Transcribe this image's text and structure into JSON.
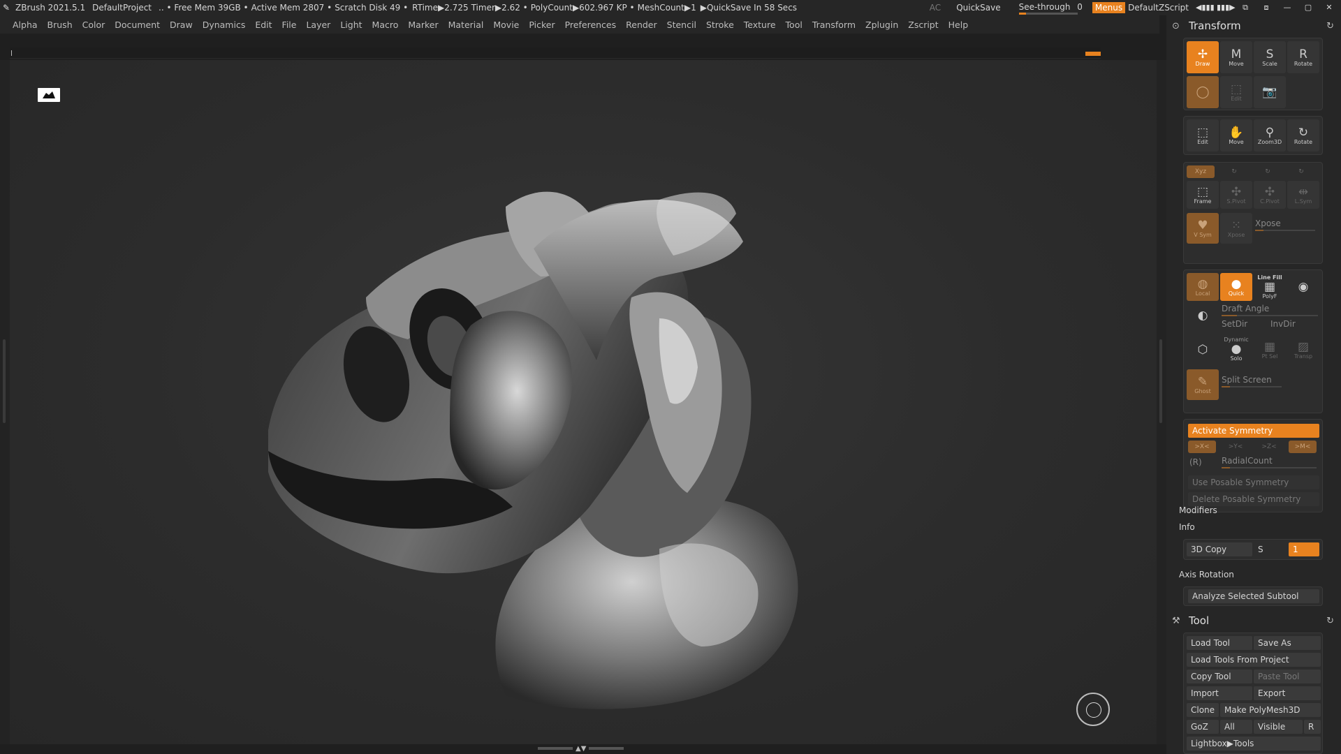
{
  "titlebar": {
    "app": "ZBrush 2021.5.1",
    "project": "DefaultProject",
    "free_mem": ".. • Free Mem 39GB •",
    "active_mem": "Active Mem 2807 •",
    "scratch": "Scratch Disk 49 •",
    "rtime": "RTime▶2.725",
    "timer": "Timer▶2.62 •",
    "polycount": "PolyCount▶602.967 KP •",
    "meshcount": "MeshCount▶1",
    "quicksave_timer": "▶QuickSave In 58 Secs",
    "ac": "AC",
    "quicksave": "QuickSave",
    "seethrough": "See-through",
    "seethrough_value": "0",
    "menus": "Menus",
    "script": "DefaultZScript",
    "icons": [
      "◀▮▮▮",
      "▮▮▮▶",
      "⧉",
      "⧈",
      "—",
      "▢",
      "✕"
    ]
  },
  "menubar": [
    "Alpha",
    "Brush",
    "Color",
    "Document",
    "Draw",
    "Dynamics",
    "Edit",
    "File",
    "Layer",
    "Light",
    "Macro",
    "Marker",
    "Material",
    "Movie",
    "Picker",
    "Preferences",
    "Render",
    "Stencil",
    "Stroke",
    "Texture",
    "Tool",
    "Transform",
    "Zplugin",
    "Zscript",
    "Help"
  ],
  "transform": {
    "title": "Transform",
    "row1": [
      {
        "label": "Draw",
        "glyph": "✢"
      },
      {
        "label": "Move",
        "glyph": "M"
      },
      {
        "label": "Scale",
        "glyph": "S"
      },
      {
        "label": "Rotate",
        "glyph": "R"
      }
    ],
    "row2": [
      {
        "label": "",
        "glyph": "◯"
      },
      {
        "label": "Edit",
        "glyph": "⬚"
      },
      {
        "label": "",
        "glyph": "📷"
      }
    ],
    "row3": [
      {
        "label": "Edit",
        "glyph": "⬚"
      },
      {
        "label": "Move",
        "glyph": "✋"
      },
      {
        "label": "Zoom3D",
        "glyph": "⚲"
      },
      {
        "label": "Rotate",
        "glyph": "↻"
      }
    ],
    "xyz": "Xyz",
    "row4": [
      {
        "label": "Frame",
        "glyph": "⬚"
      },
      {
        "label": "S.Pivot",
        "glyph": "✣"
      },
      {
        "label": "C.Pivot",
        "glyph": "✣"
      },
      {
        "label": "L.Sym",
        "glyph": "⇹"
      }
    ],
    "vsym": "V Sym",
    "xpose_btn": "Xpose",
    "xpose_label": "Xpose",
    "local": "Local",
    "quick": "Quick",
    "linefill": "Line Fill",
    "polyf": "PolyF",
    "draft_angle": "Draft Angle",
    "setdir": "SetDir",
    "invdir": "InvDir",
    "dynamic": "Dynamic",
    "solo": "Solo",
    "ptsel": "Pt Sel",
    "transp": "Transp",
    "ghost": "Ghost",
    "split_screen": "Split Screen",
    "activate_symmetry": "Activate Symmetry",
    "axes": [
      ">X<",
      ">Y<",
      ">Z<",
      ">M<"
    ],
    "r_label": "(R)",
    "radial_count": "RadialCount",
    "use_posable": "Use Posable Symmetry",
    "delete_posable": "Delete Posable Symmetry",
    "modifiers": "Modifiers",
    "info": "Info",
    "copy3d": "3D Copy",
    "copy_s": "S",
    "copy_value": "1",
    "axis_rotation": "Axis Rotation",
    "analyze": "Analyze Selected Subtool"
  },
  "tool": {
    "title": "Tool",
    "load_tool": "Load Tool",
    "save_as": "Save As",
    "load_from_project": "Load Tools From Project",
    "copy_tool": "Copy Tool",
    "paste_tool": "Paste Tool",
    "import": "Import",
    "export": "Export",
    "clone": "Clone",
    "make_polymesh": "Make PolyMesh3D",
    "goz": "GoZ",
    "all": "All",
    "visible": "Visible",
    "r": "R",
    "lightbox": "Lightbox▶Tools"
  },
  "colors": {
    "accent": "#e8821f",
    "panel_bg": "#262626",
    "canvas_bg": "#2c2c2c"
  }
}
